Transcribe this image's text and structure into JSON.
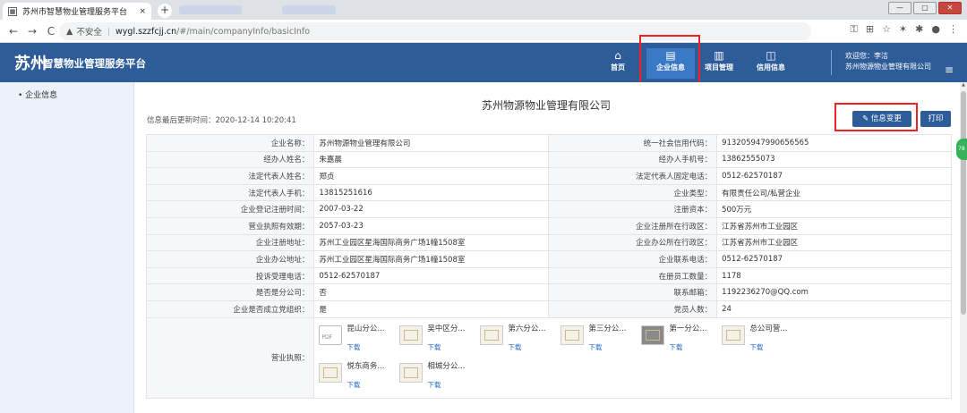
{
  "browser": {
    "tab_title": "苏州市智慧物业管理服务平台",
    "tab_close": "×",
    "new_tab": "+",
    "back": "←",
    "forward": "→",
    "reload": "C",
    "insecure_label": "不安全",
    "url_host": "wygl.szzfcjj.cn",
    "url_path": "/#/main/companyInfo/basicInfo",
    "window_controls": [
      "—",
      "▢",
      "✕"
    ]
  },
  "app": {
    "logo_text": "苏州",
    "title": "智慧物业管理服务平台",
    "nav": [
      {
        "label": "首页",
        "icon": "home-icon",
        "glyph": "⌂"
      },
      {
        "label": "企业信息",
        "icon": "clipboard-icon",
        "glyph": "▤"
      },
      {
        "label": "项目管理",
        "icon": "building-icon",
        "glyph": "▥"
      },
      {
        "label": "信用信息",
        "icon": "chart-icon",
        "glyph": "◫"
      }
    ],
    "welcome_line1": "欢迎您：李洁",
    "welcome_line2": "苏州物源物业管理有限公司",
    "menu_glyph": "≡"
  },
  "sidebar": {
    "items": [
      {
        "label": "• 企业信息"
      }
    ]
  },
  "content": {
    "company_title": "苏州物源物业管理有限公司",
    "last_updated": "信息最后更新时间：2020-12-14 10:20:41",
    "btn_change": "✎ 信息变更",
    "btn_print": "打印",
    "green_badge": "78"
  },
  "info_rows": [
    {
      "l1": "企业名称：",
      "v1": "苏州物源物业管理有限公司",
      "l2": "统一社会信用代码：",
      "v2": "913205947990656565"
    },
    {
      "l1": "经办人姓名：",
      "v1": "朱嘉晨",
      "l2": "经办人手机号：",
      "v2": "13862555073"
    },
    {
      "l1": "法定代表人姓名：",
      "v1": "郑贞",
      "l2": "法定代表人固定电话：",
      "v2": "0512-62570187"
    },
    {
      "l1": "法定代表人手机：",
      "v1": "13815251616",
      "l2": "企业类型：",
      "v2": "有限责任公司/私营企业"
    },
    {
      "l1": "企业登记注册时间：",
      "v1": "2007-03-22",
      "l2": "注册资本：",
      "v2": "500万元"
    },
    {
      "l1": "营业执照有效期：",
      "v1": "2057-03-23",
      "l2": "企业注册所在行政区：",
      "v2": "江苏省苏州市工业园区"
    },
    {
      "l1": "企业注册地址：",
      "v1": "苏州工业园区星海国际商务广场1幢1508室",
      "l2": "企业办公所在行政区：",
      "v2": "江苏省苏州市工业园区"
    },
    {
      "l1": "企业办公地址：",
      "v1": "苏州工业园区星海国际商务广场1幢1508室",
      "l2": "企业联系电话：",
      "v2": "0512-62570187"
    },
    {
      "l1": "投诉受理电话：",
      "v1": "0512-62570187",
      "l2": "在册员工数量：",
      "v2": "1178"
    },
    {
      "l1": "是否是分公司：",
      "v1": "否",
      "l2": "联系邮箱：",
      "v2": "1192236270@QQ.com"
    },
    {
      "l1": "企业是否成立党组织：",
      "v1": "是",
      "l2": "党员人数：",
      "v2": "24"
    }
  ],
  "license": {
    "label": "营业执照：",
    "download_label": "下载",
    "files": [
      {
        "name": "昆山分公...",
        "kind": "pdf",
        "thumb_text": "PDF"
      },
      {
        "name": "吴中区分...",
        "kind": "cert"
      },
      {
        "name": "第六分公...",
        "kind": "cert"
      },
      {
        "name": "第三分公...",
        "kind": "cert"
      },
      {
        "name": "第一分公...",
        "kind": "dark"
      },
      {
        "name": "总公司营...",
        "kind": "cert"
      },
      {
        "name": "悦东商务...",
        "kind": "cert"
      },
      {
        "name": "相城分公...",
        "kind": "cert"
      }
    ]
  }
}
